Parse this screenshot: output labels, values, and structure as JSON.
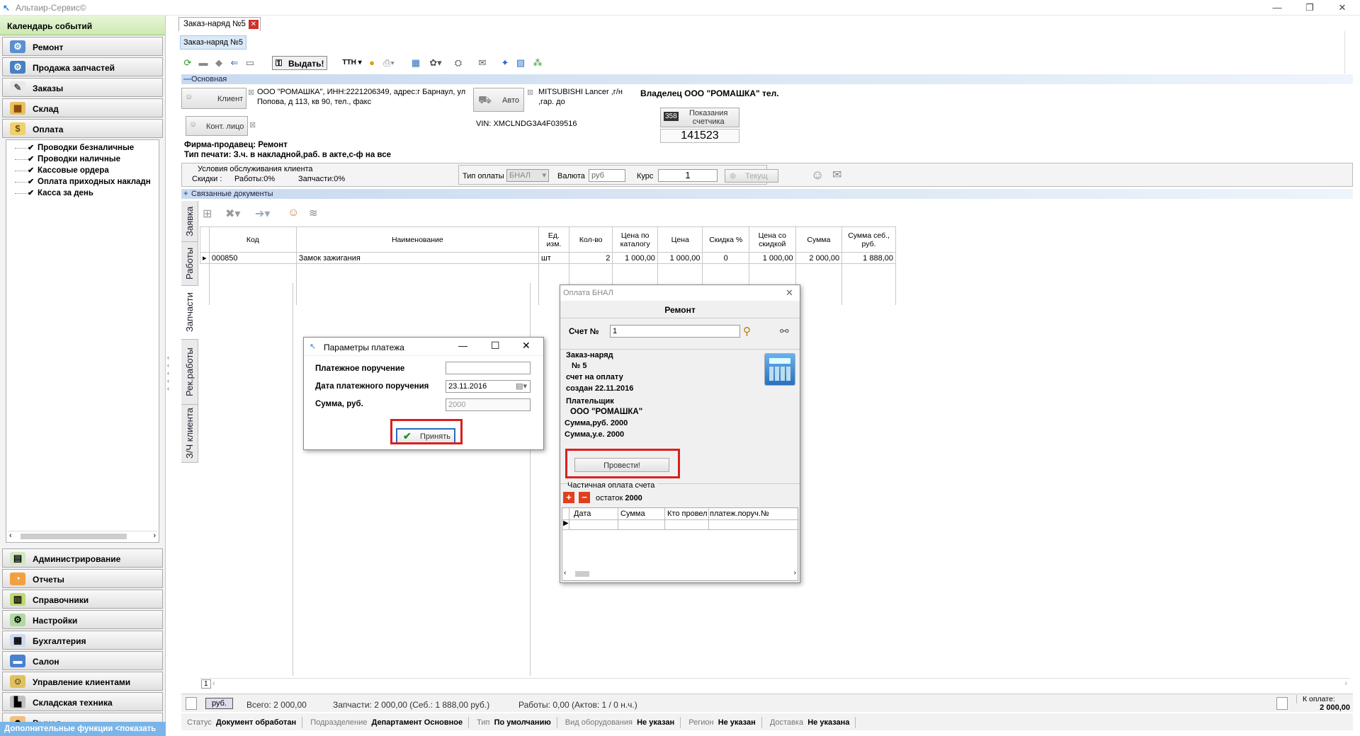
{
  "app": {
    "title": "Альтаир-Сервис©"
  },
  "left_panel": {
    "calendar": "Календарь событий",
    "top_nav": [
      "Ремонт",
      "Продажа запчастей",
      "Заказы",
      "Склад",
      "Оплата"
    ],
    "tree_items": [
      "Проводки безналичные",
      "Проводки наличные",
      "Кассовые ордера",
      "Оплата приходных накладн",
      "Касса за день"
    ],
    "bottom_nav": [
      "Администрирование",
      "Отчеты",
      "Справочники",
      "Настройки",
      "Бухгалтерия",
      "Салон",
      "Управление клиентами",
      "Складская техника",
      "Выход"
    ],
    "extra_link": "Дополнительные функции <показать"
  },
  "tab": {
    "title": "Заказ-наряд №5",
    "subtab": "Заказ-наряд №5"
  },
  "toolbar": {
    "vydat": "Выдать!",
    "tti": "ТТН"
  },
  "basic": {
    "section": "Основная",
    "client_btn": "Клиент",
    "client_info": [
      "ООО \"РОМАШКА\", ИНН:2221206349, адрес:г Барнаул, ул",
      "Попова, д 113, кв 90, тел., факс"
    ],
    "contact_btn": "Конт. лицо",
    "auto_btn": "Авто",
    "auto_info": [
      "MITSUBISHI Lancer ,г/н",
      ",гар. до"
    ],
    "vin": "VIN: XMCLNDG3A4F039516",
    "owner": "Владелец  ООО \"РОМАШКА\" тел.",
    "counter_btn": [
      "Показания",
      "счетчика"
    ],
    "counter_value": "141523",
    "seller": "Фирма-продавец: Ремонт",
    "print_type": "Тип печати: З.ч. в накладной,раб. в акте,с-ф на все"
  },
  "conditions": {
    "title": "Условия обслуживания клиента",
    "discounts": "Скидки :",
    "works": "Работы:0%",
    "parts": "Запчасти:0%",
    "pay_type_label": "Тип оплаты",
    "pay_type_value": "БНАЛ",
    "currency_label": "Валюта",
    "currency_value": "руб",
    "rate_label": "Курс",
    "rate_value": "1",
    "current_btn": "Текущ"
  },
  "linked": {
    "section": "Связанные документы"
  },
  "vtabs": [
    "Заявка",
    "Работы",
    "Запчасти",
    "Рек.работы",
    "З/Ч клиента"
  ],
  "grid": {
    "headers": [
      "Код",
      "Наименование",
      "Ед. изм.",
      "Кол-во",
      "Цена по каталогу",
      "Цена",
      "Скидка %",
      "Цена со скидкой",
      "Сумма",
      "Сумма себ., руб."
    ],
    "rows": [
      [
        "000850",
        "Замок зажигания",
        "шт",
        "2",
        "1 000,00",
        "1 000,00",
        "0",
        "1 000,00",
        "2 000,00",
        "1 888,00"
      ]
    ],
    "page": "1"
  },
  "payment_params": {
    "title": "Параметры платежа",
    "order_label": "Платежное поручение",
    "order_value": "",
    "date_label": "Дата платежного поручения",
    "date_value": "23.11.2016",
    "sum_label": "Сумма, руб.",
    "sum_value": "2000",
    "accept_btn": "Принять"
  },
  "bnal": {
    "title": "Оплата БНАЛ",
    "header": "Ремонт",
    "account_label": "Счет №",
    "account_value": "1",
    "info": [
      "Заказ-наряд",
      "№ 5",
      "счет на оплату",
      "создан 22.11.2016",
      "Плательщик",
      "ООО \"РОМАШКА\"",
      "Сумма,руб. 2000",
      "Сумма,у.е. 2000"
    ],
    "post_btn": "Провести!",
    "partial": "Частичная оплата счета",
    "remainder_label": "остаток",
    "remainder_value": "2000",
    "table_headers": [
      "Дата",
      "Сумма",
      "Кто провел",
      "платеж.поруч.№"
    ]
  },
  "bottom": {
    "currency": "руб.",
    "total": "Всего: 2 000,00",
    "parts": "Запчасти: 2 000,00 (Себ.: 1 888,00 руб.)",
    "works": "Работы: 0,00 (Актов: 1 / 0 н.ч.)",
    "to_pay_label": "К оплате:",
    "to_pay_value": "2 000,00"
  },
  "status": {
    "status_label": "Статус",
    "status_value": "Документ обработан",
    "dept_label": "Подразделение",
    "dept_value": "Департамент Основное",
    "type_label": "Тип",
    "type_value": "По умолчанию",
    "equip_label": "Вид оборудования",
    "equip_value": "Не указан",
    "region_label": "Регион",
    "region_value": "Не указан",
    "delivery_label": "Доставка",
    "delivery_value": "Не указана"
  },
  "colors": {
    "accent": "#2a6cc0",
    "highlight": "#d9201e",
    "calendar_bg": "#cde9b0"
  }
}
